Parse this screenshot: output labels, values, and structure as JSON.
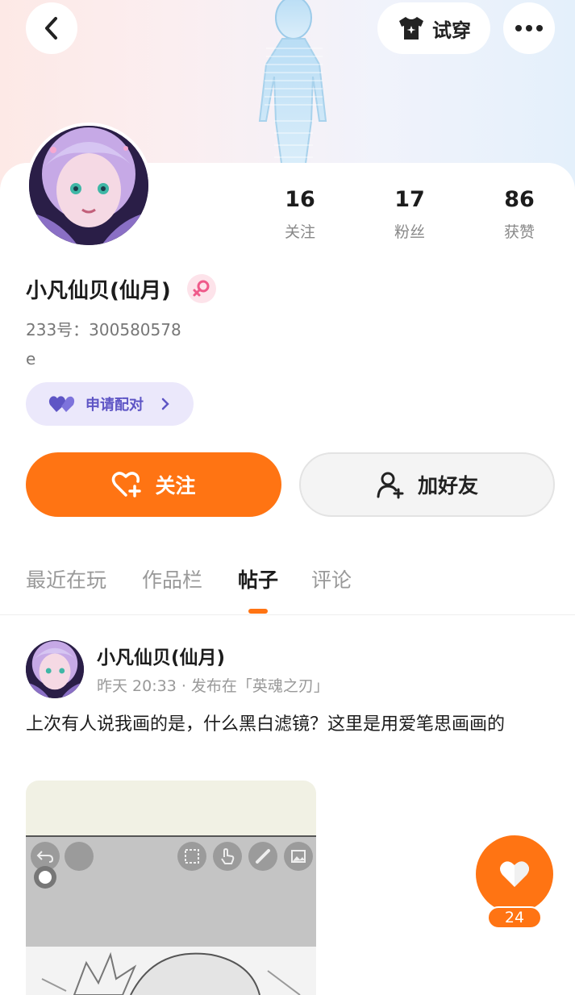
{
  "header": {
    "tryon_label": "试穿"
  },
  "profile": {
    "username": "小凡仙贝(仙月)",
    "uid_text": "233号：300580578",
    "bio": "e",
    "pair_label": "申请配对",
    "stats": [
      {
        "value": "16",
        "label": "关注"
      },
      {
        "value": "17",
        "label": "粉丝"
      },
      {
        "value": "86",
        "label": "获赞"
      }
    ]
  },
  "actions": {
    "follow_label": "关注",
    "add_friend_label": "加好友"
  },
  "tabs": [
    {
      "label": "最近在玩",
      "active": false
    },
    {
      "label": "作品栏",
      "active": false
    },
    {
      "label": "帖子",
      "active": true
    },
    {
      "label": "评论",
      "active": false
    }
  ],
  "post": {
    "author": "小凡仙贝(仙月)",
    "meta": "昨天 20:33 · 发布在「英魂之刃」",
    "text": "上次有人说我画的是，什么黑白滤镜？这里是用爱笔思画画的",
    "like_count": "24"
  },
  "colors": {
    "accent": "#ff7413",
    "pair_bg": "#ebe8fb",
    "pair_text": "#5e55c5",
    "gender": "#ef5a8a"
  }
}
